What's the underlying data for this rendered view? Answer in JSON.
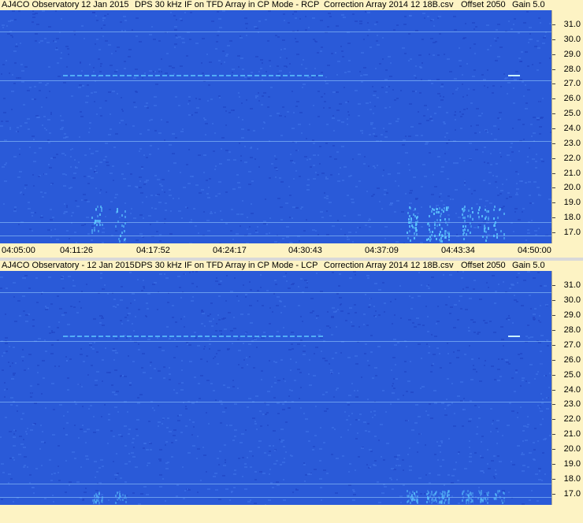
{
  "chart_data": [
    {
      "type": "heatmap",
      "title": {
        "observatory": "AJ4CO Observatory",
        "date": "12 Jan 2015",
        "instrument": "DPS 30 kHz IF on TFD Array in CP Mode - RCP",
        "correction": "Correction Array 2014 12 18B.csv",
        "offset": "Offset 2050",
        "gain": "Gain 5.0"
      },
      "y_ticks": [
        "31.0",
        "30.0",
        "29.0",
        "28.0",
        "27.0",
        "26.0",
        "25.0",
        "24.0",
        "23.0",
        "22.0",
        "21.0",
        "20.0",
        "19.0",
        "18.0",
        "17.0"
      ],
      "x_ticks": [
        "04:05:00",
        "04:11:26",
        "04:17:52",
        "04:24:17",
        "04:30:43",
        "04:37:09",
        "04:43:34",
        "04:50:00"
      ],
      "colors": {
        "background": "#2a5ad8",
        "dark": "#1f44c4",
        "bright": "#5ec8ff",
        "line": "#9fd3ff"
      }
    },
    {
      "type": "heatmap",
      "title": {
        "observatory": "AJ4CO Observatory - 12 Jan 2015",
        "date": "",
        "instrument": "DPS 30 kHz IF on TFD Array in CP Mode - LCP",
        "correction": "Correction Array 2014 12 18B.csv",
        "offset": "Offset 2050",
        "gain": "Gain 5.0"
      },
      "y_ticks": [
        "31.0",
        "30.0",
        "29.0",
        "28.0",
        "27.0",
        "26.0",
        "25.0",
        "24.0",
        "23.0",
        "22.0",
        "21.0",
        "20.0",
        "19.0",
        "18.0",
        "17.0"
      ],
      "x_ticks": [],
      "colors": {
        "background": "#2a5ad8",
        "dark": "#1f44c4",
        "bright": "#5ec8ff",
        "line": "#9fd3ff"
      }
    }
  ]
}
